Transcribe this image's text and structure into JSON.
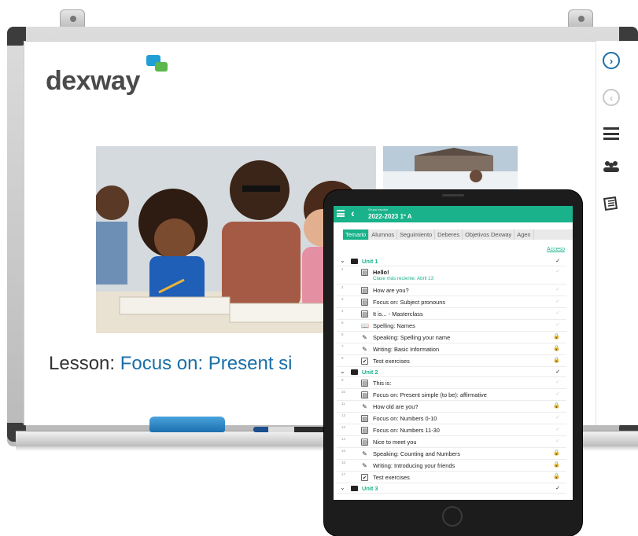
{
  "brand": {
    "logo_text": "dexway",
    "logo_color": "#4a4a4a",
    "bubble_colors": [
      "#1f9fd3",
      "#5bb64b"
    ]
  },
  "board": {
    "lesson_prefix": "Lesson: ",
    "lesson_title_visible": "Focus on: Present si",
    "accent_color": "#1a6fa8"
  },
  "sidebar": {
    "items": [
      {
        "icon": "chevron-right-circle-icon",
        "glyph": "›",
        "enabled": true
      },
      {
        "icon": "chevron-left-circle-icon",
        "glyph": "‹",
        "enabled": false
      },
      {
        "icon": "list-icon"
      },
      {
        "icon": "users-icon",
        "glyph": "👥"
      },
      {
        "icon": "notebook-icon",
        "glyph": "📰"
      }
    ]
  },
  "app": {
    "header_color": "#19b28b",
    "group_label": "Grupo escolar",
    "group_name": "2022-2023 1º A",
    "back_glyph": "‹",
    "tabs": [
      "Temario",
      "Alumnos",
      "Seguimiento",
      "Deberes",
      "Objetivos Dexway",
      "Agen"
    ],
    "active_tab": "Temario",
    "access_label": "Acceso",
    "units": [
      {
        "title": "Unit 1",
        "status": "✓",
        "lessons": [
          {
            "num": "1",
            "icon": "page-icon",
            "glyph": "▤",
            "label": "Hello!",
            "sub": "Clase más reciente: Abril 13",
            "status": "✓",
            "bold": true
          },
          {
            "num": "2",
            "icon": "page-icon",
            "glyph": "▤",
            "label": "How are you?",
            "status": "✓"
          },
          {
            "num": "3",
            "icon": "page-icon",
            "glyph": "▤",
            "label": "Focus on: Subject pronouns",
            "status": "✓"
          },
          {
            "num": "4",
            "icon": "page-icon",
            "glyph": "▤",
            "label": "It is... - Masterclass",
            "status": "✓"
          },
          {
            "num": "5",
            "icon": "book-icon",
            "glyph": "📖",
            "label": "Spelling: Names",
            "status": "✓"
          },
          {
            "num": "6",
            "icon": "pencil-icon",
            "glyph": "✎",
            "label": "Speaking: Spelling your name",
            "status": "🔒"
          },
          {
            "num": "7",
            "icon": "pencil-icon",
            "glyph": "✎",
            "label": "Writing: Basic Information",
            "status": "🔒"
          },
          {
            "num": "8",
            "icon": "checkbox-icon",
            "glyph": "✔",
            "label": "Test exercises",
            "status": "🔒",
            "status_dark": true
          }
        ]
      },
      {
        "title": "Unit 2",
        "status": "✓",
        "lessons": [
          {
            "num": "9",
            "icon": "page-icon",
            "glyph": "▤",
            "label": "This is:",
            "status": "✓"
          },
          {
            "num": "10",
            "icon": "page-icon",
            "glyph": "▤",
            "label": "Focus on: Present simple (to be): affirmative",
            "status": "✓"
          },
          {
            "num": "11",
            "icon": "pencil-icon",
            "glyph": "✎",
            "label": "How old are you?",
            "status": "🔒"
          },
          {
            "num": "12",
            "icon": "page-icon",
            "glyph": "▤",
            "label": "Focus on: Numbers 0-10",
            "status": "✓"
          },
          {
            "num": "13",
            "icon": "page-icon",
            "glyph": "▤",
            "label": "Focus on: Numbers 11-30",
            "status": "✓"
          },
          {
            "num": "14",
            "icon": "page-icon",
            "glyph": "▤",
            "label": "Nice to meet you",
            "status": "✓"
          },
          {
            "num": "15",
            "icon": "pencil-icon",
            "glyph": "✎",
            "label": "Speaking: Counting and Numbers",
            "status": "🔒"
          },
          {
            "num": "16",
            "icon": "pencil-icon",
            "glyph": "✎",
            "label": "Writing: Introducing your friends",
            "status": "🔒"
          },
          {
            "num": "17",
            "icon": "checkbox-icon",
            "glyph": "✔",
            "label": "Test exercises",
            "status": "🔒"
          }
        ]
      },
      {
        "title": "Unit 3",
        "status": "✓",
        "lessons": []
      }
    ]
  }
}
